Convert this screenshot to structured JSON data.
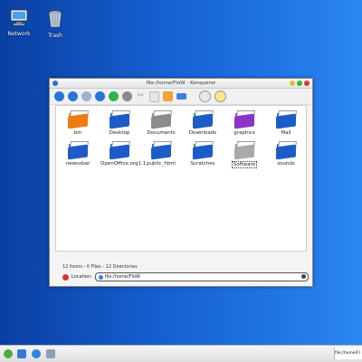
{
  "desktop": {
    "icons": [
      {
        "label": "Network"
      },
      {
        "label": "Trash"
      }
    ]
  },
  "window": {
    "title": "file:/home/FloW - Konqueror",
    "colors": {
      "folder_blue": "#1d5cc8",
      "folder_orange": "#f07a12",
      "folder_gray": "#8c8c8c",
      "folder_green": "#2e9a2e",
      "folder_purple": "#8a35c5"
    },
    "items": [
      {
        "label": "bin"
      },
      {
        "label": "Desktop"
      },
      {
        "label": "Documents"
      },
      {
        "label": "Downloads"
      },
      {
        "label": "graphics"
      },
      {
        "label": "Mail"
      },
      {
        "label": "newsxbar"
      },
      {
        "label": "OpenOffice.org1.1"
      },
      {
        "label": "public_html"
      },
      {
        "label": "Scratches"
      },
      {
        "label": "Software"
      },
      {
        "label": "sounds"
      }
    ],
    "status": "12 Items - 0 Files - 12 Directories",
    "location_label": "Location:",
    "location_value": "file:/home/FloW"
  },
  "taskbar": {
    "task_label": "file:/home/Fl"
  }
}
